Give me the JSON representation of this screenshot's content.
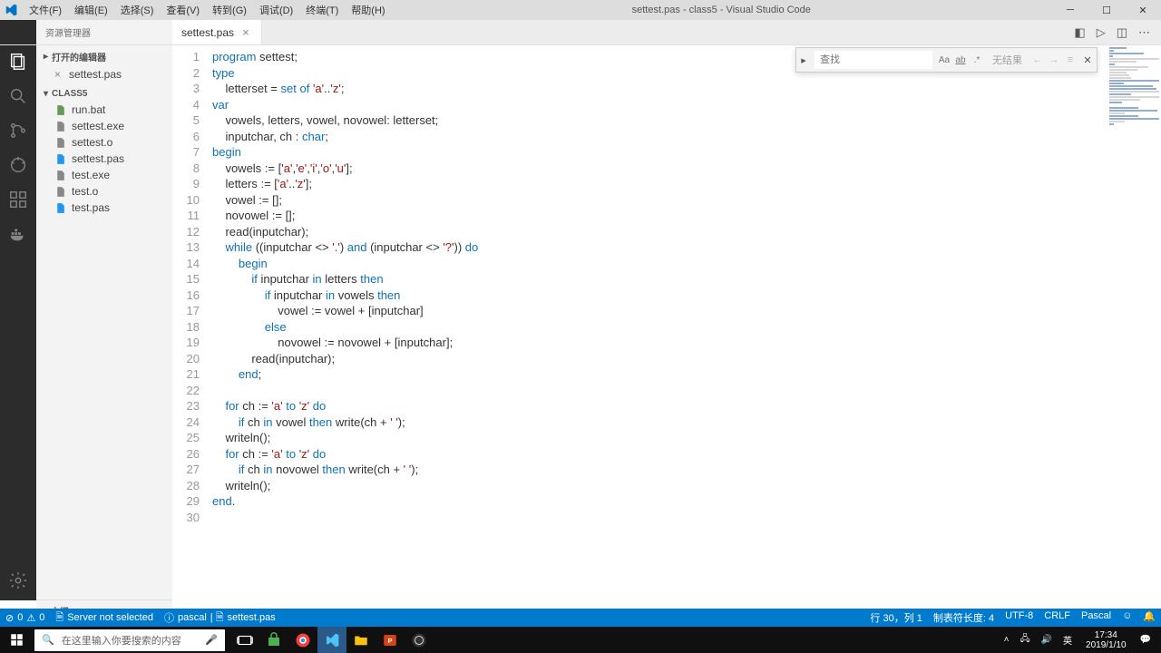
{
  "title_bar": {
    "app_title": "settest.pas - class5 - Visual Studio Code",
    "menu": [
      "文件(F)",
      "编辑(E)",
      "选择(S)",
      "查看(V)",
      "转到(G)",
      "调试(D)",
      "终端(T)",
      "帮助(H)"
    ]
  },
  "tabs": {
    "explorer_title": "资源管理器",
    "open": [
      {
        "name": "settest.pas",
        "active": true
      }
    ]
  },
  "sidebar": {
    "open_editors_label": "打开的编辑器",
    "open_editors": [
      {
        "name": "settest.pas"
      }
    ],
    "folder_label": "CLASS5",
    "files": [
      "run.bat",
      "settest.exe",
      "settest.o",
      "settest.pas",
      "test.exe",
      "test.o",
      "test.pas"
    ],
    "outline_label": "大纲"
  },
  "find": {
    "placeholder": "查找",
    "result": "无结果"
  },
  "code": {
    "lines": [
      {
        "n": 1,
        "seg": [
          [
            "kw",
            "program"
          ],
          [
            "op",
            " settest;"
          ]
        ]
      },
      {
        "n": 2,
        "seg": [
          [
            "kw",
            "type"
          ]
        ]
      },
      {
        "n": 3,
        "seg": [
          [
            "op",
            "    letterset = "
          ],
          [
            "kw",
            "set"
          ],
          [
            "op",
            " "
          ],
          [
            "kw",
            "of"
          ],
          [
            "op",
            " "
          ],
          [
            "str",
            "'a'"
          ],
          [
            "op",
            ".."
          ],
          [
            "str",
            "'z'"
          ],
          [
            "op",
            ";"
          ]
        ]
      },
      {
        "n": 4,
        "seg": [
          [
            "kw",
            "var"
          ]
        ]
      },
      {
        "n": 5,
        "seg": [
          [
            "op",
            "    vowels, letters, vowel, novowel: letterset;"
          ]
        ]
      },
      {
        "n": 6,
        "seg": [
          [
            "op",
            "    inputchar, ch : "
          ],
          [
            "ty",
            "char"
          ],
          [
            "op",
            ";"
          ]
        ]
      },
      {
        "n": 7,
        "seg": [
          [
            "kw",
            "begin"
          ]
        ]
      },
      {
        "n": 8,
        "seg": [
          [
            "op",
            "    vowels := ["
          ],
          [
            "str",
            "'a'"
          ],
          [
            "op",
            ","
          ],
          [
            "str",
            "'e'"
          ],
          [
            "op",
            ","
          ],
          [
            "str",
            "'i'"
          ],
          [
            "op",
            ","
          ],
          [
            "str",
            "'o'"
          ],
          [
            "op",
            ","
          ],
          [
            "str",
            "'u'"
          ],
          [
            "op",
            "];"
          ]
        ]
      },
      {
        "n": 9,
        "seg": [
          [
            "op",
            "    letters := ["
          ],
          [
            "str",
            "'a'"
          ],
          [
            "op",
            ".."
          ],
          [
            "str",
            "'z'"
          ],
          [
            "op",
            "];"
          ]
        ]
      },
      {
        "n": 10,
        "seg": [
          [
            "op",
            "    vowel := [];"
          ]
        ]
      },
      {
        "n": 11,
        "seg": [
          [
            "op",
            "    novowel := [];"
          ]
        ]
      },
      {
        "n": 12,
        "seg": [
          [
            "op",
            "    read(inputchar);"
          ]
        ]
      },
      {
        "n": 13,
        "seg": [
          [
            "op",
            "    "
          ],
          [
            "kw",
            "while"
          ],
          [
            "op",
            " ((inputchar <> "
          ],
          [
            "str",
            "'.'"
          ],
          [
            "op",
            ") "
          ],
          [
            "kw",
            "and"
          ],
          [
            "op",
            " (inputchar <> "
          ],
          [
            "str",
            "'?'"
          ],
          [
            "op",
            ")) "
          ],
          [
            "kw",
            "do"
          ]
        ]
      },
      {
        "n": 14,
        "seg": [
          [
            "op",
            "        "
          ],
          [
            "kw",
            "begin"
          ]
        ]
      },
      {
        "n": 15,
        "seg": [
          [
            "op",
            "            "
          ],
          [
            "kw",
            "if"
          ],
          [
            "op",
            " inputchar "
          ],
          [
            "kw",
            "in"
          ],
          [
            "op",
            " letters "
          ],
          [
            "kw",
            "then"
          ]
        ]
      },
      {
        "n": 16,
        "seg": [
          [
            "op",
            "                "
          ],
          [
            "kw",
            "if"
          ],
          [
            "op",
            " inputchar "
          ],
          [
            "kw",
            "in"
          ],
          [
            "op",
            " vowels "
          ],
          [
            "kw",
            "then"
          ]
        ]
      },
      {
        "n": 17,
        "seg": [
          [
            "op",
            "                    vowel := vowel + [inputchar]"
          ]
        ]
      },
      {
        "n": 18,
        "seg": [
          [
            "op",
            "                "
          ],
          [
            "kw",
            "else"
          ]
        ]
      },
      {
        "n": 19,
        "seg": [
          [
            "op",
            "                    novowel := novowel + [inputchar];"
          ]
        ]
      },
      {
        "n": 20,
        "seg": [
          [
            "op",
            "            read(inputchar);"
          ]
        ]
      },
      {
        "n": 21,
        "seg": [
          [
            "op",
            "        "
          ],
          [
            "kw",
            "end"
          ],
          [
            "op",
            ";"
          ]
        ]
      },
      {
        "n": 22,
        "seg": [
          [
            "op",
            ""
          ]
        ]
      },
      {
        "n": 23,
        "seg": [
          [
            "op",
            "    "
          ],
          [
            "kw",
            "for"
          ],
          [
            "op",
            " ch := "
          ],
          [
            "str",
            "'a'"
          ],
          [
            "op",
            " "
          ],
          [
            "kw",
            "to"
          ],
          [
            "op",
            " "
          ],
          [
            "str",
            "'z'"
          ],
          [
            "op",
            " "
          ],
          [
            "kw",
            "do"
          ]
        ]
      },
      {
        "n": 24,
        "seg": [
          [
            "op",
            "        "
          ],
          [
            "kw",
            "if"
          ],
          [
            "op",
            " ch "
          ],
          [
            "kw",
            "in"
          ],
          [
            "op",
            " vowel "
          ],
          [
            "kw",
            "then"
          ],
          [
            "op",
            " write(ch + "
          ],
          [
            "str",
            "' '"
          ],
          [
            "op",
            ");"
          ]
        ]
      },
      {
        "n": 25,
        "seg": [
          [
            "op",
            "    writeln();"
          ]
        ]
      },
      {
        "n": 26,
        "seg": [
          [
            "op",
            "    "
          ],
          [
            "kw",
            "for"
          ],
          [
            "op",
            " ch := "
          ],
          [
            "str",
            "'a'"
          ],
          [
            "op",
            " "
          ],
          [
            "kw",
            "to"
          ],
          [
            "op",
            " "
          ],
          [
            "str",
            "'z'"
          ],
          [
            "op",
            " "
          ],
          [
            "kw",
            "do"
          ]
        ]
      },
      {
        "n": 27,
        "seg": [
          [
            "op",
            "        "
          ],
          [
            "kw",
            "if"
          ],
          [
            "op",
            " ch "
          ],
          [
            "kw",
            "in"
          ],
          [
            "op",
            " novowel "
          ],
          [
            "kw",
            "then"
          ],
          [
            "op",
            " write(ch + "
          ],
          [
            "str",
            "' '"
          ],
          [
            "op",
            ");"
          ]
        ]
      },
      {
        "n": 28,
        "seg": [
          [
            "op",
            "    writeln();"
          ]
        ]
      },
      {
        "n": 29,
        "seg": [
          [
            "kw",
            "end"
          ],
          [
            "op",
            "."
          ]
        ]
      },
      {
        "n": 30,
        "seg": [
          [
            "op",
            ""
          ]
        ]
      }
    ]
  },
  "status": {
    "errors": "0",
    "warnings": "0",
    "server": "Server not selected",
    "lang_indicator": "pascal",
    "file_indicator": "settest.pas",
    "cursor": "行 30，列 1",
    "tab_size": "制表符长度: 4",
    "encoding": "UTF-8",
    "eol": "CRLF",
    "language": "Pascal",
    "feedback": "☺"
  },
  "taskbar": {
    "search_placeholder": "在这里输入你要搜索的内容",
    "clock_time": "17:34",
    "clock_date": "2019/1/10",
    "ime": "英"
  }
}
